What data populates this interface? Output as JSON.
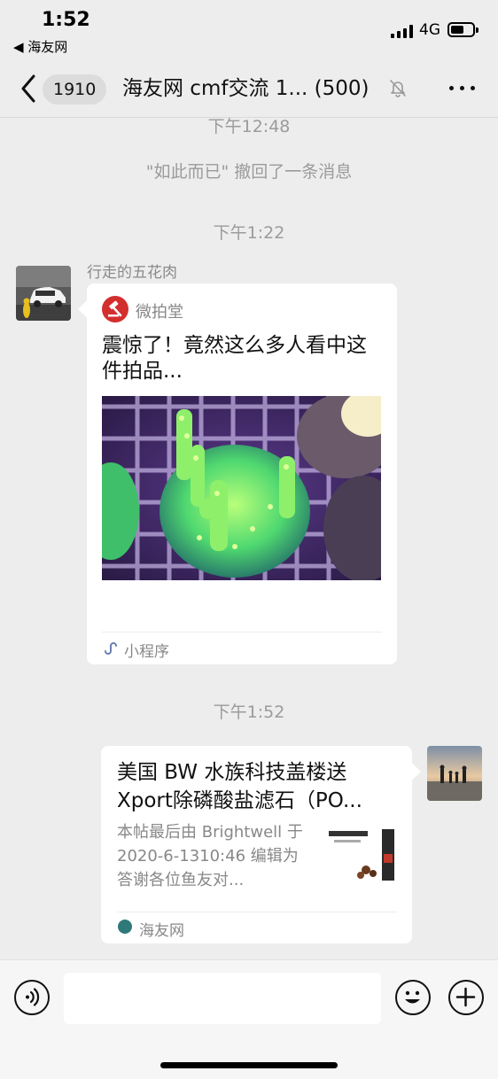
{
  "status_bar": {
    "time": "1:52",
    "back_app": "◀ 海友网",
    "network": "4G"
  },
  "nav": {
    "unread_count": "1910",
    "title": "海友网 cmf交流 1... (500)",
    "muted_icon": "bell-slash-icon",
    "more_icon": "more-icon"
  },
  "messages": {
    "time1": "下午12:48",
    "recall_notice": "\"如此而已\" 撤回了一条消息",
    "time2": "下午1:22",
    "sender1": "行走的五花肉",
    "mini_program": {
      "app_name": "微拍堂",
      "title": "震惊了！竟然这么多人看中这件拍品...",
      "footer": "小程序"
    },
    "time3": "下午1:52",
    "link_card": {
      "title": "美国 BW 水族科技盖楼送 Xport除磷酸盐滤石（PO...",
      "description": "本帖最后由 Brightwell 于 2020-6-1310:46 编辑为答谢各位鱼友对...",
      "source": "海友网"
    }
  },
  "input_bar": {
    "voice_icon": "voice-icon",
    "emoji_icon": "emoji-icon",
    "plus_icon": "plus-icon",
    "input_value": ""
  }
}
